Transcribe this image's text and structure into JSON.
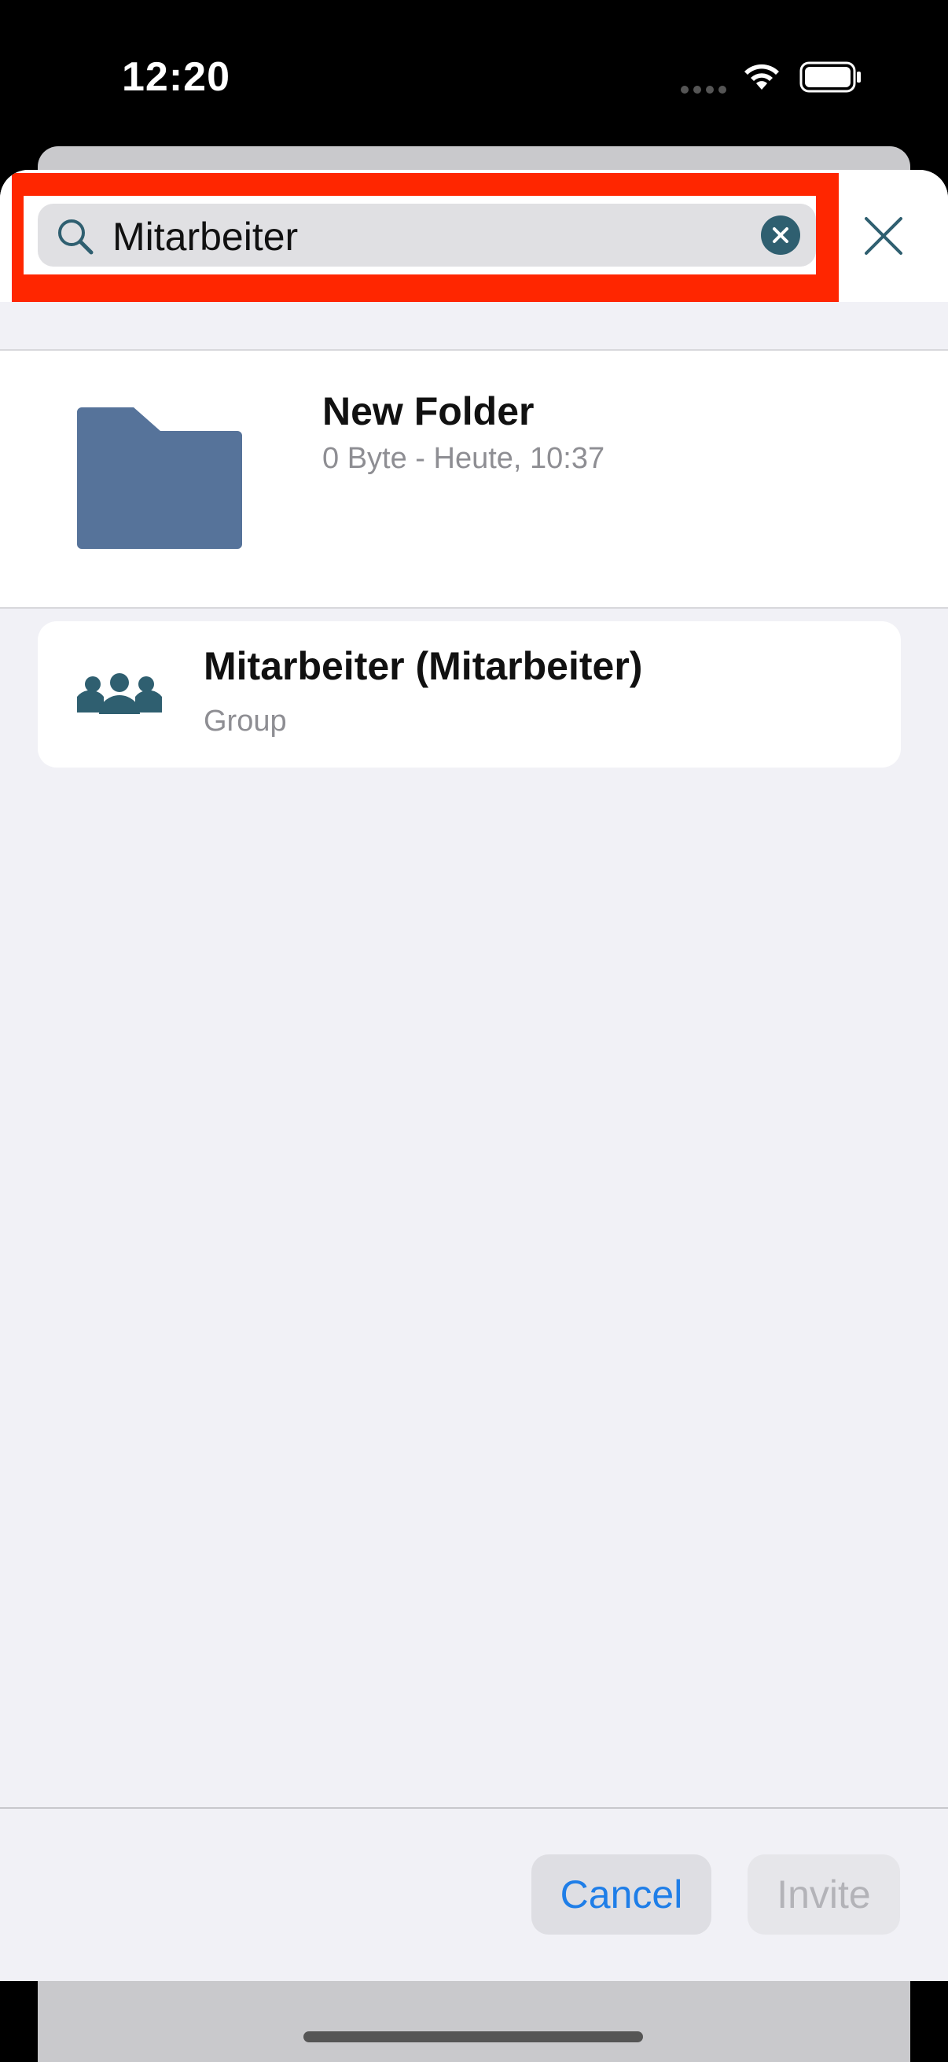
{
  "status_bar": {
    "time": "12:20"
  },
  "search": {
    "query": "Mitarbeiter"
  },
  "results": {
    "folder": {
      "name": "New Folder",
      "meta": "0 Byte - Heute, 10:37"
    },
    "group": {
      "name": "Mitarbeiter (Mitarbeiter)",
      "type": "Group"
    }
  },
  "footer": {
    "cancel_label": "Cancel",
    "invite_label": "Invite"
  },
  "icons": {
    "search": "search-icon",
    "clear": "clear-icon",
    "close": "close-icon",
    "folder": "folder-icon",
    "group": "group-icon"
  },
  "colors": {
    "highlight": "#ff2600",
    "accent_blue": "#1f7ee8",
    "folder": "#56739a",
    "icon_teal": "#2f5f70"
  }
}
